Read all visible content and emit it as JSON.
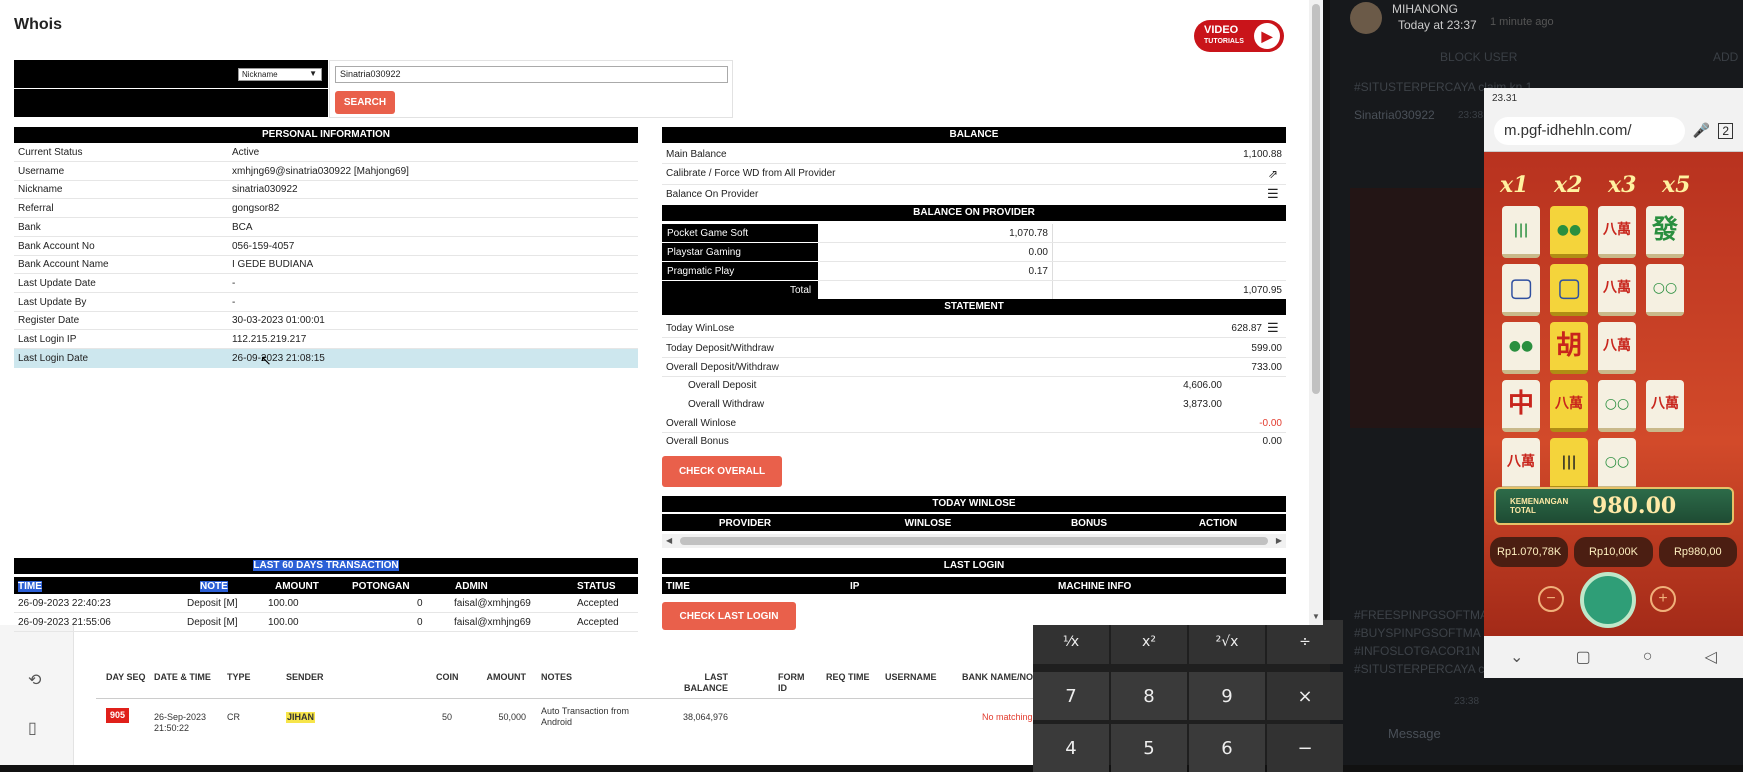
{
  "chat": {
    "user_name": "MIHANONG",
    "time": "Today at 23:37",
    "ago": "1 minute ago",
    "block_user": "BLOCK USER",
    "add": "ADD",
    "msg1": "#SITUSTERPERCAYA claim kn 1",
    "msg2": "Sinatria030922",
    "msg2_time": "23:38",
    "hashtags": [
      "#FREESPINPGSOFTMA",
      "#BUYSPINPGSOFTMA",
      "#INFOSLOTGACOR1N",
      "#SITUSTERPERCAYA cl"
    ],
    "time2": "23:38",
    "message_placeholder": "Message"
  },
  "phone": {
    "clock": "23.31",
    "url": "m.pgf-idhehln.com/",
    "multipliers": [
      "x1",
      "x2",
      "x3",
      "x5"
    ],
    "win_label": "KEMENANGAN TOTAL",
    "win_value": "980.00",
    "chips": [
      "Rp1.070,78K",
      "Rp10,00K",
      "Rp980,00"
    ],
    "tiles": [
      "發",
      "八萬",
      "中",
      "胡",
      "發",
      "八萬",
      "中",
      "八萬",
      "胡"
    ]
  },
  "calc": {
    "keys": [
      "¹⁄x",
      "x²",
      "²√x",
      "÷",
      "7",
      "8",
      "9",
      "×",
      "4",
      "5",
      "6",
      "−"
    ]
  },
  "bottom": {
    "headers": [
      "DAY SEQ",
      "DATE & TIME",
      "TYPE",
      "SENDER",
      "COIN",
      "AMOUNT",
      "NOTES",
      "LAST BALANCE",
      "FORM ID",
      "REQ TIME",
      "USERNAME",
      "BANK NAME/NO"
    ],
    "row": {
      "seq": "905",
      "datetime": "26-Sep-2023 21:50:22",
      "type": "CR",
      "sender": "JIHAN",
      "coin": "50",
      "amount": "50,000",
      "notes": "Auto Transaction from Android",
      "last_balance": "38,064,976",
      "bank": "No matching"
    }
  },
  "whois": {
    "title": "Whois",
    "video_label": "VIDEO",
    "video_sub": "TUTORIALS",
    "search": {
      "select": "Nickname",
      "value": "Sinatria030922",
      "button": "SEARCH"
    },
    "personal": {
      "header": "PERSONAL INFORMATION",
      "rows": [
        [
          "Current Status",
          "Active"
        ],
        [
          "Username",
          "xmhjng69@sinatria030922  [Mahjong69]"
        ],
        [
          "Nickname",
          "sinatria030922"
        ],
        [
          "Referral",
          "gongsor82"
        ],
        [
          "Bank",
          "BCA"
        ],
        [
          "Bank Account No",
          "056-159-4057"
        ],
        [
          "Bank Account Name",
          "I GEDE BUDIANA"
        ],
        [
          "Last Update Date",
          "-"
        ],
        [
          "Last Update By",
          "-"
        ],
        [
          "Register Date",
          "30-03-2023 01:00:01"
        ],
        [
          "Last Login IP",
          "112.215.219.217"
        ],
        [
          "Last Login Date",
          "26-09-2023 21:08:15"
        ]
      ]
    },
    "balance": {
      "header": "BALANCE",
      "main_label": "Main Balance",
      "main_value": "1,100.88",
      "calibrate": "Calibrate / Force WD from All Provider",
      "on_provider": "Balance On Provider"
    },
    "bop": {
      "header": "BALANCE ON PROVIDER",
      "rows": [
        [
          "Pocket Game Soft",
          "1,070.78"
        ],
        [
          "Playstar Gaming",
          "0.00"
        ],
        [
          "Pragmatic Play",
          "0.17"
        ]
      ],
      "total_label": "Total",
      "total_value": "1,070.95"
    },
    "statement": {
      "header": "STATEMENT",
      "rows": [
        [
          "Today WinLose",
          "628.87"
        ],
        [
          "Today Deposit/Withdraw",
          "599.00"
        ],
        [
          "Overall Deposit/Withdraw",
          "733.00"
        ]
      ],
      "sub": [
        [
          "Overall Deposit",
          "4,606.00"
        ],
        [
          "Overall Withdraw",
          "3,873.00"
        ]
      ],
      "winlose_label": "Overall Winlose",
      "winlose_value": "-0.00",
      "bonus_label": "Overall Bonus",
      "bonus_value": "0.00",
      "button": "CHECK OVERALL"
    },
    "today_winlose": {
      "header": "TODAY WINLOSE",
      "cols": [
        "PROVIDER",
        "WINLOSE",
        "BONUS",
        "ACTION"
      ]
    },
    "last_login": {
      "header": "LAST LOGIN",
      "cols": [
        "TIME",
        "IP",
        "MACHINE INFO"
      ],
      "button": "CHECK LAST LOGIN"
    },
    "tx": {
      "header": "LAST 60 DAYS TRANSACTION",
      "cols": [
        "TIME",
        "NOTE",
        "AMOUNT",
        "POTONGAN",
        "ADMIN",
        "STATUS"
      ],
      "rows": [
        [
          "26-09-2023 22:40:23",
          "Deposit [M]",
          "100.00",
          "0",
          "faisal@xmhjng69",
          "Accepted"
        ],
        [
          "26-09-2023 21:55:06",
          "Deposit [M]",
          "100.00",
          "0",
          "faisal@xmhjng69",
          "Accepted"
        ]
      ]
    }
  }
}
